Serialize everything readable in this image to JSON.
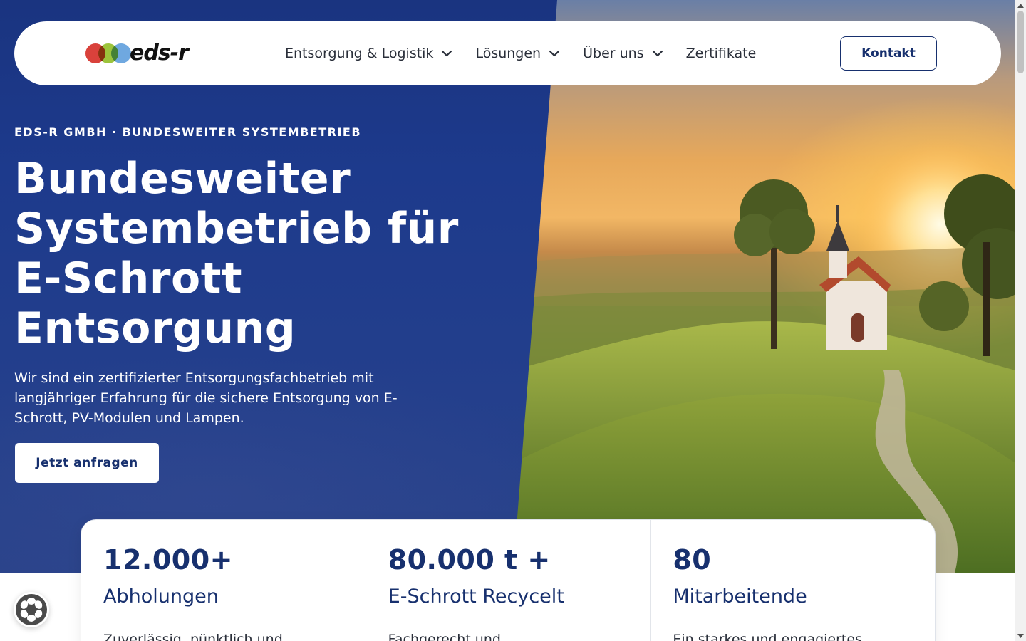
{
  "brand": {
    "logo_text": "eds-r"
  },
  "nav": {
    "items": [
      {
        "label": "Entsorgung & Logistik",
        "has_dropdown": true
      },
      {
        "label": "Lösungen",
        "has_dropdown": true
      },
      {
        "label": "Über uns",
        "has_dropdown": true
      },
      {
        "label": "Zertifikate",
        "has_dropdown": false
      }
    ],
    "contact_button": "Kontakt"
  },
  "hero": {
    "eyebrow": "EDS-R GMBH · BUNDESWEITER SYSTEMBETRIEB",
    "title": "Bundesweiter Systembetrieb für E-Schrott Entsorgung",
    "subtitle": "Wir sind ein zertifizierter Entsorgungsfachbetrieb mit langjähriger Erfahrung für die sichere Entsorgung von E-Schrott, PV-Modulen und Lampen.",
    "cta_button": "Jetzt anfragen",
    "image_alt": "chapel-on-hill-sunset-photo"
  },
  "stats": [
    {
      "value": "12.000+",
      "label": "Abholungen",
      "desc": "Zuverlässig, pünktlich und"
    },
    {
      "value": "80.000 t +",
      "label": "E-Schrott Recycelt",
      "desc": "Fachgerecht und"
    },
    {
      "value": "80",
      "label": "Mitarbeitende",
      "desc": "Ein starkes und engagiertes"
    }
  ],
  "colors": {
    "primary": "#17306e",
    "hero_blue": "#1d3a8c",
    "logo_red": "#d9413b",
    "logo_green": "#9cc43c",
    "logo_blue": "#6fa8e0"
  },
  "icons": {
    "dropdown": "chevron-down-icon",
    "floating_badge": "cookie-settings-icon"
  }
}
